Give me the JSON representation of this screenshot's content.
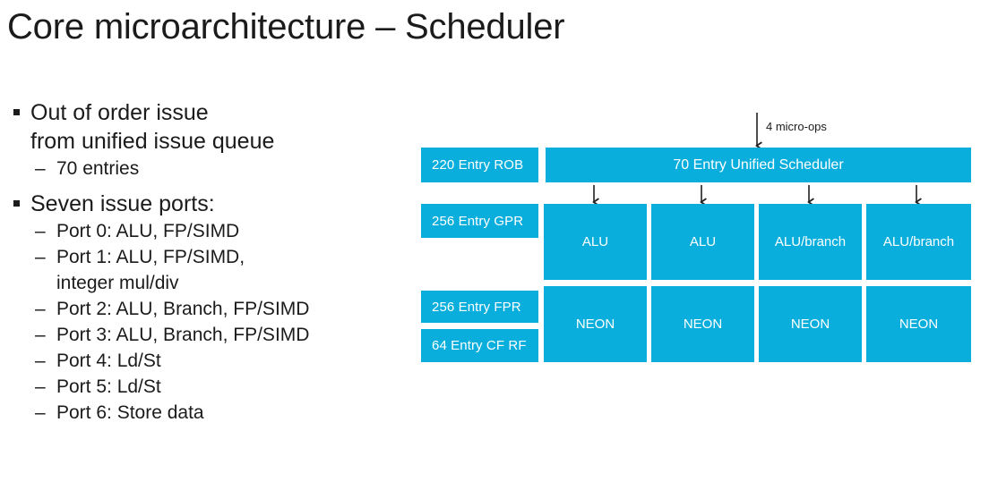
{
  "slide": {
    "title": "Core microarchitecture – Scheduler"
  },
  "bullets": [
    {
      "level": 1,
      "marker": "square",
      "line1": "Out of order issue",
      "line2": "from unified issue queue"
    },
    {
      "level": 2,
      "marker": "–",
      "text": "70 entries"
    },
    {
      "level": 1,
      "marker": "square",
      "line1": "Seven issue ports:"
    },
    {
      "level": 2,
      "marker": "–",
      "text": "Port 0: ALU, FP/SIMD"
    },
    {
      "level": 2,
      "marker": "–",
      "text": "Port 1: ALU, FP/SIMD,",
      "cont": "integer mul/div"
    },
    {
      "level": 2,
      "marker": "–",
      "text": "Port 2: ALU, Branch, FP/SIMD"
    },
    {
      "level": 2,
      "marker": "–",
      "text": "Port 3: ALU, Branch, FP/SIMD"
    },
    {
      "level": 2,
      "marker": "–",
      "text": "Port 4: Ld/St"
    },
    {
      "level": 2,
      "marker": "–",
      "text": "Port 5: Ld/St"
    },
    {
      "level": 2,
      "marker": "–",
      "text": "Port 6: Store data"
    }
  ],
  "diagram": {
    "accent_color": "#09AEDD",
    "text_color": "#FFFFFF",
    "input_caption": "4 micro-ops",
    "scheduler": "70 Entry Unified Scheduler",
    "left_labels": [
      "220 Entry ROB",
      "256 Entry GPR",
      "256 Entry FPR",
      "64 Entry CF RF"
    ],
    "alu_row": [
      "ALU",
      "ALU",
      "ALU/branch",
      "ALU/branch"
    ],
    "neon_row": [
      "NEON",
      "NEON",
      "NEON",
      "NEON"
    ]
  }
}
